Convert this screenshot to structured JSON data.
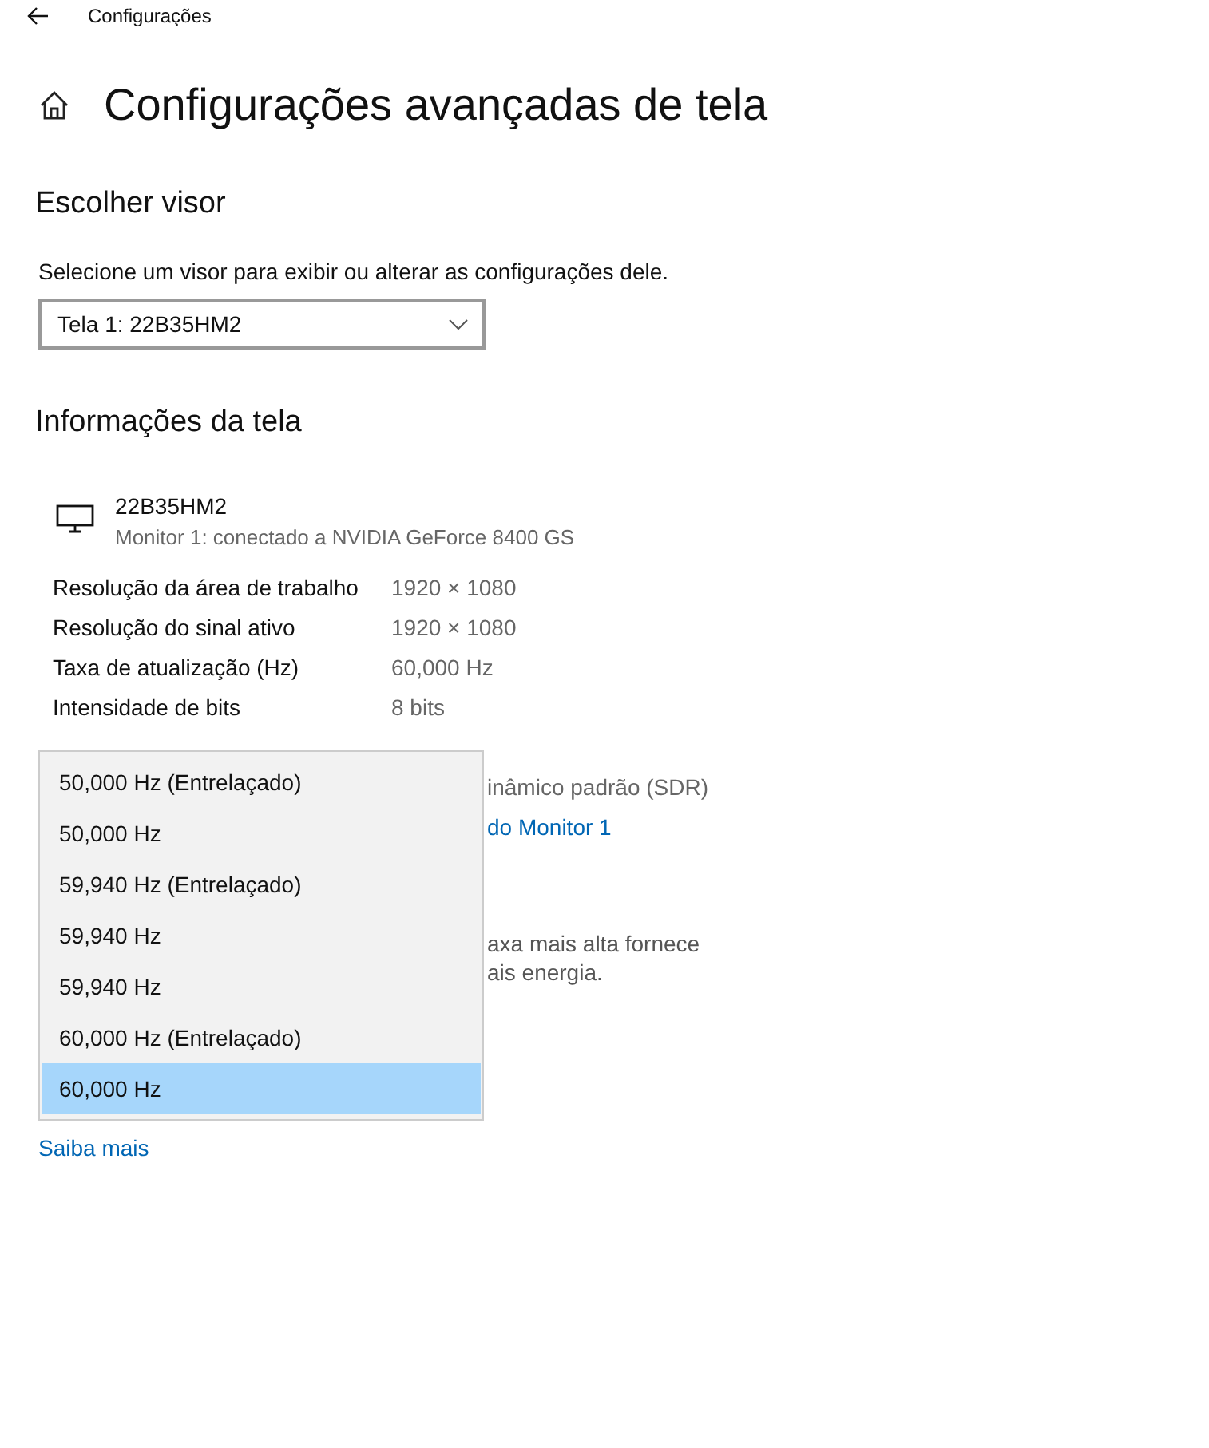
{
  "header": {
    "title": "Configurações"
  },
  "page_title": "Configurações avançadas de tela",
  "choose_display": {
    "heading": "Escolher visor",
    "prompt": "Selecione um visor para exibir ou alterar as configurações dele.",
    "dropdown": {
      "value": "Tela 1: 22B35HM2"
    }
  },
  "display_info": {
    "heading": "Informações da tela",
    "monitor": {
      "name": "22B35HM2",
      "subtitle": "Monitor 1: conectado a NVIDIA GeForce 8400 GS"
    },
    "rows": [
      {
        "label": "Resolução da área de trabalho",
        "value": "1920 × 1080"
      },
      {
        "label": "Resolução do sinal ativo",
        "value": "1920 × 1080"
      },
      {
        "label": "Taxa de atualização (Hz)",
        "value": "60,000 Hz"
      },
      {
        "label": "Intensidade de bits",
        "value": "8 bits"
      }
    ],
    "partial_value": "inâmico padrão (SDR)",
    "partial_link": "do Monitor 1"
  },
  "partial_text_lines": [
    "axa mais alta fornece",
    "ais energia."
  ],
  "refresh_menu": {
    "items": [
      {
        "label": "50,000 Hz (Entrelaçado)",
        "selected": false
      },
      {
        "label": "50,000 Hz",
        "selected": false
      },
      {
        "label": "59,940 Hz (Entrelaçado)",
        "selected": false
      },
      {
        "label": "59,940 Hz",
        "selected": false
      },
      {
        "label": "59,940 Hz",
        "selected": false
      },
      {
        "label": "60,000 Hz (Entrelaçado)",
        "selected": false
      },
      {
        "label": "60,000 Hz",
        "selected": true
      }
    ]
  },
  "learn_more": "Saiba mais"
}
